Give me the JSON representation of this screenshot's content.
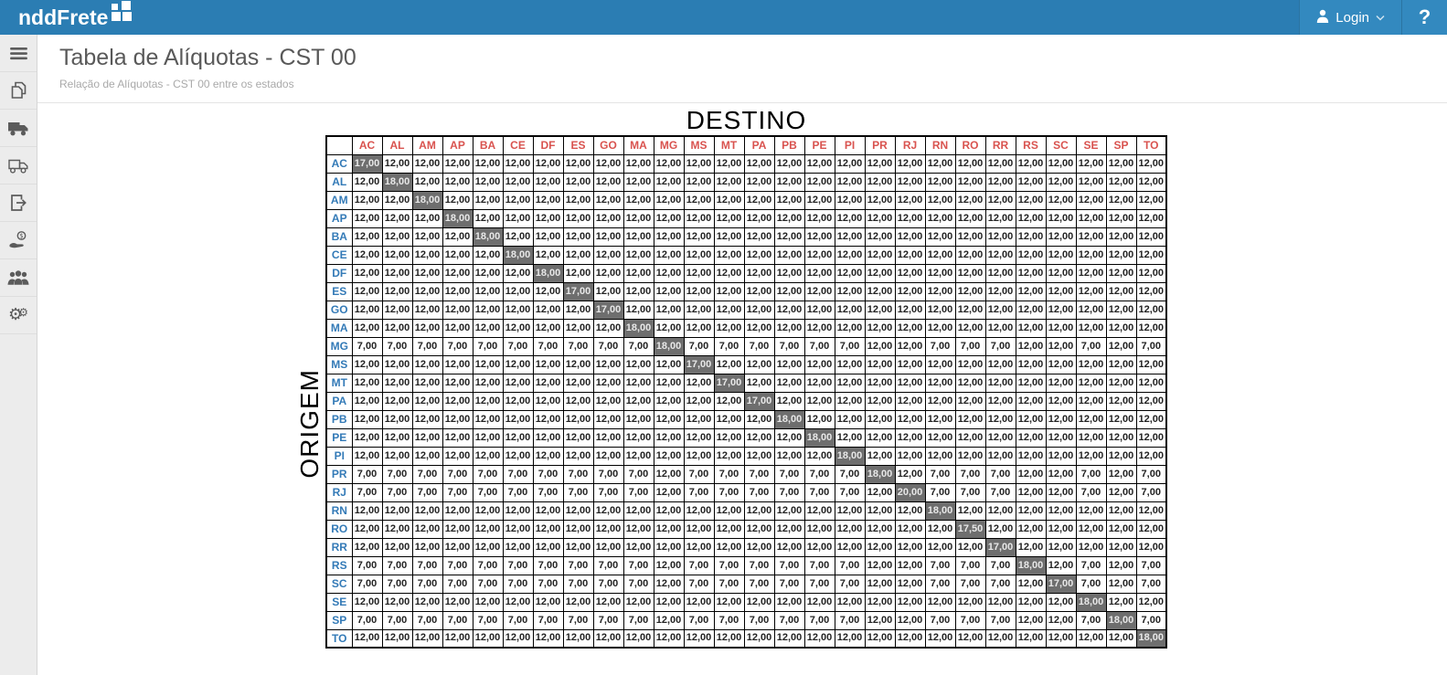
{
  "header": {
    "brand": "nddFrete",
    "login_label": "Login",
    "help_label": "?"
  },
  "sidebar": {
    "items": [
      {
        "name": "menu",
        "icon": "hamburger-icon"
      },
      {
        "name": "documents",
        "icon": "copy-icon"
      },
      {
        "name": "freight",
        "icon": "truck-icon"
      },
      {
        "name": "delivery",
        "icon": "truck-outline-icon"
      },
      {
        "name": "export",
        "icon": "export-icon"
      },
      {
        "name": "billing",
        "icon": "money-hand-icon"
      },
      {
        "name": "users",
        "icon": "users-icon"
      },
      {
        "name": "settings",
        "icon": "gears-icon"
      }
    ]
  },
  "page": {
    "title": "Tabela de Alíquotas - CST 00",
    "subtitle": "Relação de Alíquotas - CST 00 entre os estados"
  },
  "matrix": {
    "destination_label": "DESTINO",
    "origin_label": "ORIGEM",
    "states": [
      "AC",
      "AL",
      "AM",
      "AP",
      "BA",
      "CE",
      "DF",
      "ES",
      "GO",
      "MA",
      "MG",
      "MS",
      "MT",
      "PA",
      "PB",
      "PE",
      "PI",
      "PR",
      "RJ",
      "RN",
      "RO",
      "RR",
      "RS",
      "SC",
      "SE",
      "SP",
      "TO"
    ],
    "rows": [
      {
        "origin": "AC",
        "values": [
          "17,00",
          "12,00",
          "12,00",
          "12,00",
          "12,00",
          "12,00",
          "12,00",
          "12,00",
          "12,00",
          "12,00",
          "12,00",
          "12,00",
          "12,00",
          "12,00",
          "12,00",
          "12,00",
          "12,00",
          "12,00",
          "12,00",
          "12,00",
          "12,00",
          "12,00",
          "12,00",
          "12,00",
          "12,00",
          "12,00",
          "12,00"
        ]
      },
      {
        "origin": "AL",
        "values": [
          "12,00",
          "18,00",
          "12,00",
          "12,00",
          "12,00",
          "12,00",
          "12,00",
          "12,00",
          "12,00",
          "12,00",
          "12,00",
          "12,00",
          "12,00",
          "12,00",
          "12,00",
          "12,00",
          "12,00",
          "12,00",
          "12,00",
          "12,00",
          "12,00",
          "12,00",
          "12,00",
          "12,00",
          "12,00",
          "12,00",
          "12,00"
        ]
      },
      {
        "origin": "AM",
        "values": [
          "12,00",
          "12,00",
          "18,00",
          "12,00",
          "12,00",
          "12,00",
          "12,00",
          "12,00",
          "12,00",
          "12,00",
          "12,00",
          "12,00",
          "12,00",
          "12,00",
          "12,00",
          "12,00",
          "12,00",
          "12,00",
          "12,00",
          "12,00",
          "12,00",
          "12,00",
          "12,00",
          "12,00",
          "12,00",
          "12,00",
          "12,00"
        ]
      },
      {
        "origin": "AP",
        "values": [
          "12,00",
          "12,00",
          "12,00",
          "18,00",
          "12,00",
          "12,00",
          "12,00",
          "12,00",
          "12,00",
          "12,00",
          "12,00",
          "12,00",
          "12,00",
          "12,00",
          "12,00",
          "12,00",
          "12,00",
          "12,00",
          "12,00",
          "12,00",
          "12,00",
          "12,00",
          "12,00",
          "12,00",
          "12,00",
          "12,00",
          "12,00"
        ]
      },
      {
        "origin": "BA",
        "values": [
          "12,00",
          "12,00",
          "12,00",
          "12,00",
          "18,00",
          "12,00",
          "12,00",
          "12,00",
          "12,00",
          "12,00",
          "12,00",
          "12,00",
          "12,00",
          "12,00",
          "12,00",
          "12,00",
          "12,00",
          "12,00",
          "12,00",
          "12,00",
          "12,00",
          "12,00",
          "12,00",
          "12,00",
          "12,00",
          "12,00",
          "12,00"
        ]
      },
      {
        "origin": "CE",
        "values": [
          "12,00",
          "12,00",
          "12,00",
          "12,00",
          "12,00",
          "18,00",
          "12,00",
          "12,00",
          "12,00",
          "12,00",
          "12,00",
          "12,00",
          "12,00",
          "12,00",
          "12,00",
          "12,00",
          "12,00",
          "12,00",
          "12,00",
          "12,00",
          "12,00",
          "12,00",
          "12,00",
          "12,00",
          "12,00",
          "12,00",
          "12,00"
        ]
      },
      {
        "origin": "DF",
        "values": [
          "12,00",
          "12,00",
          "12,00",
          "12,00",
          "12,00",
          "12,00",
          "18,00",
          "12,00",
          "12,00",
          "12,00",
          "12,00",
          "12,00",
          "12,00",
          "12,00",
          "12,00",
          "12,00",
          "12,00",
          "12,00",
          "12,00",
          "12,00",
          "12,00",
          "12,00",
          "12,00",
          "12,00",
          "12,00",
          "12,00",
          "12,00"
        ]
      },
      {
        "origin": "ES",
        "values": [
          "12,00",
          "12,00",
          "12,00",
          "12,00",
          "12,00",
          "12,00",
          "12,00",
          "17,00",
          "12,00",
          "12,00",
          "12,00",
          "12,00",
          "12,00",
          "12,00",
          "12,00",
          "12,00",
          "12,00",
          "12,00",
          "12,00",
          "12,00",
          "12,00",
          "12,00",
          "12,00",
          "12,00",
          "12,00",
          "12,00",
          "12,00"
        ]
      },
      {
        "origin": "GO",
        "values": [
          "12,00",
          "12,00",
          "12,00",
          "12,00",
          "12,00",
          "12,00",
          "12,00",
          "12,00",
          "17,00",
          "12,00",
          "12,00",
          "12,00",
          "12,00",
          "12,00",
          "12,00",
          "12,00",
          "12,00",
          "12,00",
          "12,00",
          "12,00",
          "12,00",
          "12,00",
          "12,00",
          "12,00",
          "12,00",
          "12,00",
          "12,00"
        ]
      },
      {
        "origin": "MA",
        "values": [
          "12,00",
          "12,00",
          "12,00",
          "12,00",
          "12,00",
          "12,00",
          "12,00",
          "12,00",
          "12,00",
          "18,00",
          "12,00",
          "12,00",
          "12,00",
          "12,00",
          "12,00",
          "12,00",
          "12,00",
          "12,00",
          "12,00",
          "12,00",
          "12,00",
          "12,00",
          "12,00",
          "12,00",
          "12,00",
          "12,00",
          "12,00"
        ]
      },
      {
        "origin": "MG",
        "values": [
          "7,00",
          "7,00",
          "7,00",
          "7,00",
          "7,00",
          "7,00",
          "7,00",
          "7,00",
          "7,00",
          "7,00",
          "18,00",
          "7,00",
          "7,00",
          "7,00",
          "7,00",
          "7,00",
          "7,00",
          "12,00",
          "12,00",
          "7,00",
          "7,00",
          "7,00",
          "12,00",
          "12,00",
          "7,00",
          "12,00",
          "7,00"
        ]
      },
      {
        "origin": "MS",
        "values": [
          "12,00",
          "12,00",
          "12,00",
          "12,00",
          "12,00",
          "12,00",
          "12,00",
          "12,00",
          "12,00",
          "12,00",
          "12,00",
          "17,00",
          "12,00",
          "12,00",
          "12,00",
          "12,00",
          "12,00",
          "12,00",
          "12,00",
          "12,00",
          "12,00",
          "12,00",
          "12,00",
          "12,00",
          "12,00",
          "12,00",
          "12,00"
        ]
      },
      {
        "origin": "MT",
        "values": [
          "12,00",
          "12,00",
          "12,00",
          "12,00",
          "12,00",
          "12,00",
          "12,00",
          "12,00",
          "12,00",
          "12,00",
          "12,00",
          "12,00",
          "17,00",
          "12,00",
          "12,00",
          "12,00",
          "12,00",
          "12,00",
          "12,00",
          "12,00",
          "12,00",
          "12,00",
          "12,00",
          "12,00",
          "12,00",
          "12,00",
          "12,00"
        ]
      },
      {
        "origin": "PA",
        "values": [
          "12,00",
          "12,00",
          "12,00",
          "12,00",
          "12,00",
          "12,00",
          "12,00",
          "12,00",
          "12,00",
          "12,00",
          "12,00",
          "12,00",
          "12,00",
          "17,00",
          "12,00",
          "12,00",
          "12,00",
          "12,00",
          "12,00",
          "12,00",
          "12,00",
          "12,00",
          "12,00",
          "12,00",
          "12,00",
          "12,00",
          "12,00"
        ]
      },
      {
        "origin": "PB",
        "values": [
          "12,00",
          "12,00",
          "12,00",
          "12,00",
          "12,00",
          "12,00",
          "12,00",
          "12,00",
          "12,00",
          "12,00",
          "12,00",
          "12,00",
          "12,00",
          "12,00",
          "18,00",
          "12,00",
          "12,00",
          "12,00",
          "12,00",
          "12,00",
          "12,00",
          "12,00",
          "12,00",
          "12,00",
          "12,00",
          "12,00",
          "12,00"
        ]
      },
      {
        "origin": "PE",
        "values": [
          "12,00",
          "12,00",
          "12,00",
          "12,00",
          "12,00",
          "12,00",
          "12,00",
          "12,00",
          "12,00",
          "12,00",
          "12,00",
          "12,00",
          "12,00",
          "12,00",
          "12,00",
          "18,00",
          "12,00",
          "12,00",
          "12,00",
          "12,00",
          "12,00",
          "12,00",
          "12,00",
          "12,00",
          "12,00",
          "12,00",
          "12,00"
        ]
      },
      {
        "origin": "PI",
        "values": [
          "12,00",
          "12,00",
          "12,00",
          "12,00",
          "12,00",
          "12,00",
          "12,00",
          "12,00",
          "12,00",
          "12,00",
          "12,00",
          "12,00",
          "12,00",
          "12,00",
          "12,00",
          "12,00",
          "18,00",
          "12,00",
          "12,00",
          "12,00",
          "12,00",
          "12,00",
          "12,00",
          "12,00",
          "12,00",
          "12,00",
          "12,00"
        ]
      },
      {
        "origin": "PR",
        "values": [
          "7,00",
          "7,00",
          "7,00",
          "7,00",
          "7,00",
          "7,00",
          "7,00",
          "7,00",
          "7,00",
          "7,00",
          "12,00",
          "7,00",
          "7,00",
          "7,00",
          "7,00",
          "7,00",
          "7,00",
          "18,00",
          "12,00",
          "7,00",
          "7,00",
          "7,00",
          "12,00",
          "12,00",
          "7,00",
          "12,00",
          "7,00"
        ]
      },
      {
        "origin": "RJ",
        "values": [
          "7,00",
          "7,00",
          "7,00",
          "7,00",
          "7,00",
          "7,00",
          "7,00",
          "7,00",
          "7,00",
          "7,00",
          "12,00",
          "7,00",
          "7,00",
          "7,00",
          "7,00",
          "7,00",
          "7,00",
          "12,00",
          "20,00",
          "7,00",
          "7,00",
          "7,00",
          "12,00",
          "12,00",
          "7,00",
          "12,00",
          "7,00"
        ]
      },
      {
        "origin": "RN",
        "values": [
          "12,00",
          "12,00",
          "12,00",
          "12,00",
          "12,00",
          "12,00",
          "12,00",
          "12,00",
          "12,00",
          "12,00",
          "12,00",
          "12,00",
          "12,00",
          "12,00",
          "12,00",
          "12,00",
          "12,00",
          "12,00",
          "12,00",
          "18,00",
          "12,00",
          "12,00",
          "12,00",
          "12,00",
          "12,00",
          "12,00",
          "12,00"
        ]
      },
      {
        "origin": "RO",
        "values": [
          "12,00",
          "12,00",
          "12,00",
          "12,00",
          "12,00",
          "12,00",
          "12,00",
          "12,00",
          "12,00",
          "12,00",
          "12,00",
          "12,00",
          "12,00",
          "12,00",
          "12,00",
          "12,00",
          "12,00",
          "12,00",
          "12,00",
          "12,00",
          "17,50",
          "12,00",
          "12,00",
          "12,00",
          "12,00",
          "12,00",
          "12,00"
        ]
      },
      {
        "origin": "RR",
        "values": [
          "12,00",
          "12,00",
          "12,00",
          "12,00",
          "12,00",
          "12,00",
          "12,00",
          "12,00",
          "12,00",
          "12,00",
          "12,00",
          "12,00",
          "12,00",
          "12,00",
          "12,00",
          "12,00",
          "12,00",
          "12,00",
          "12,00",
          "12,00",
          "12,00",
          "17,00",
          "12,00",
          "12,00",
          "12,00",
          "12,00",
          "12,00"
        ]
      },
      {
        "origin": "RS",
        "values": [
          "7,00",
          "7,00",
          "7,00",
          "7,00",
          "7,00",
          "7,00",
          "7,00",
          "7,00",
          "7,00",
          "7,00",
          "12,00",
          "7,00",
          "7,00",
          "7,00",
          "7,00",
          "7,00",
          "7,00",
          "12,00",
          "12,00",
          "7,00",
          "7,00",
          "7,00",
          "18,00",
          "12,00",
          "7,00",
          "12,00",
          "7,00"
        ]
      },
      {
        "origin": "SC",
        "values": [
          "7,00",
          "7,00",
          "7,00",
          "7,00",
          "7,00",
          "7,00",
          "7,00",
          "7,00",
          "7,00",
          "7,00",
          "12,00",
          "7,00",
          "7,00",
          "7,00",
          "7,00",
          "7,00",
          "7,00",
          "12,00",
          "12,00",
          "7,00",
          "7,00",
          "7,00",
          "12,00",
          "17,00",
          "7,00",
          "12,00",
          "7,00"
        ]
      },
      {
        "origin": "SE",
        "values": [
          "12,00",
          "12,00",
          "12,00",
          "12,00",
          "12,00",
          "12,00",
          "12,00",
          "12,00",
          "12,00",
          "12,00",
          "12,00",
          "12,00",
          "12,00",
          "12,00",
          "12,00",
          "12,00",
          "12,00",
          "12,00",
          "12,00",
          "12,00",
          "12,00",
          "12,00",
          "12,00",
          "12,00",
          "18,00",
          "12,00",
          "12,00"
        ]
      },
      {
        "origin": "SP",
        "values": [
          "7,00",
          "7,00",
          "7,00",
          "7,00",
          "7,00",
          "7,00",
          "7,00",
          "7,00",
          "7,00",
          "7,00",
          "12,00",
          "7,00",
          "7,00",
          "7,00",
          "7,00",
          "7,00",
          "7,00",
          "12,00",
          "12,00",
          "7,00",
          "7,00",
          "7,00",
          "12,00",
          "12,00",
          "7,00",
          "18,00",
          "7,00"
        ]
      },
      {
        "origin": "TO",
        "values": [
          "12,00",
          "12,00",
          "12,00",
          "12,00",
          "12,00",
          "12,00",
          "12,00",
          "12,00",
          "12,00",
          "12,00",
          "12,00",
          "12,00",
          "12,00",
          "12,00",
          "12,00",
          "12,00",
          "12,00",
          "12,00",
          "12,00",
          "12,00",
          "12,00",
          "12,00",
          "12,00",
          "12,00",
          "12,00",
          "12,00",
          "18,00"
        ]
      }
    ]
  },
  "colors": {
    "header_bg": "#2b7db3",
    "header_bg_light": "#3389bf",
    "header_text": "#ffffff",
    "sidebar_bg": "#ececec",
    "sidebar_icon": "#5b5b5b",
    "title_text": "#595959",
    "subtitle_text": "#a9a9a9",
    "col_header_text": "#d9534f",
    "row_header_text": "#337ab7",
    "diagonal_bg": "#6e6e6e",
    "diagonal_text": "#e8e8e8",
    "cell_text": "#222222",
    "table_border": "#000000"
  }
}
